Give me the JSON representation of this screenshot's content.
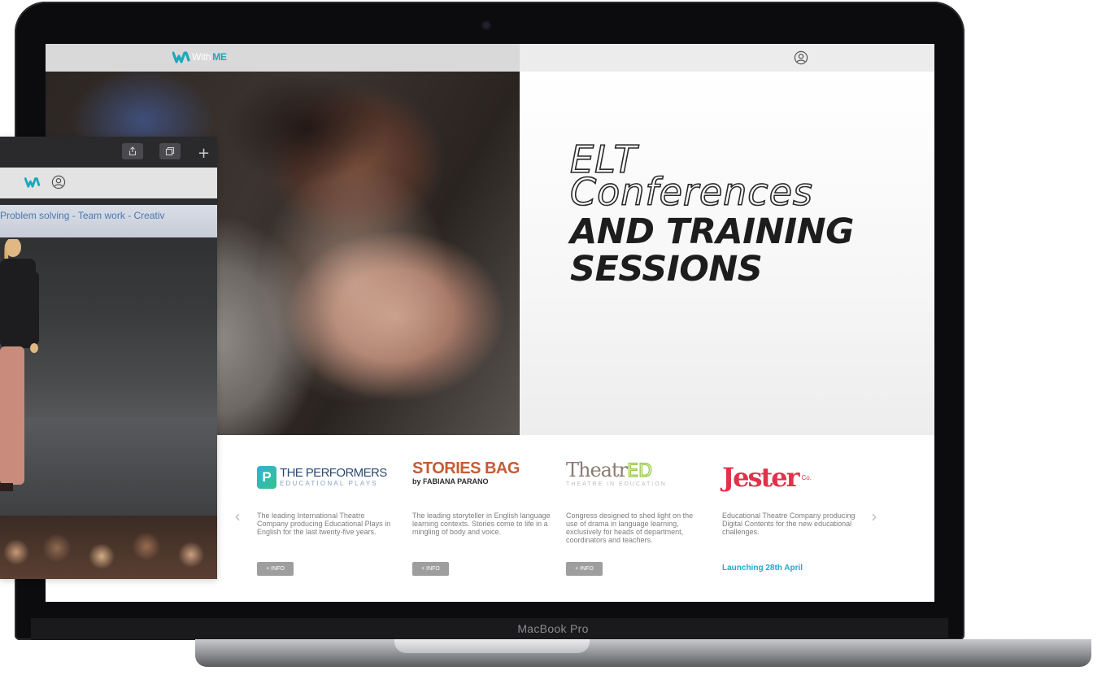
{
  "laptop": {
    "chin_label": "MacBook Pro"
  },
  "site": {
    "logo_prefix": "With",
    "logo_suffix": "ME"
  },
  "hero": {
    "line1": "ELT",
    "line2": "Conferences",
    "line3": "AND TRAINING",
    "line4": "SESSIONS"
  },
  "carousel": {
    "prev_icon": "chevron-left-icon",
    "next_icon": "chevron-right-icon",
    "cards": [
      {
        "logo_title": "THE PERFORMERS",
        "logo_sub": "EDUCATIONAL PLAYS",
        "description": "The leading International Theatre Company producing Educational Plays in English for the last twenty-five years.",
        "button": "+ INFO"
      },
      {
        "logo_title": "STORIES BAG",
        "logo_sub": "by FABIANA PARANO",
        "description": "The leading storyteller in English language learning contexts. Stories come to life in a mingling of body and voice.",
        "button": "+ INFO"
      },
      {
        "logo_title": "Theatr",
        "logo_title_accent": "ED",
        "logo_sub": "THEATRE IN EDUCATION",
        "description": "Congress designed to shed light on the use of drama in language learning, exclusively for heads of department, coordinators and teachers.",
        "button": "+ INFO"
      },
      {
        "logo_title": "Jester",
        "logo_title_accent": "Co.",
        "description": "Educational Theatre Company producing Digital Contents for the new educational challenges.",
        "launch": "Launching 28th April"
      }
    ]
  },
  "device": {
    "banner_text": "Problem solving - Team work - Creativ",
    "plus": "+"
  },
  "colors": {
    "brand": "#1aa8bd",
    "launch": "#21a9cf",
    "jester": "#e3314a",
    "stories": "#c45c34"
  }
}
